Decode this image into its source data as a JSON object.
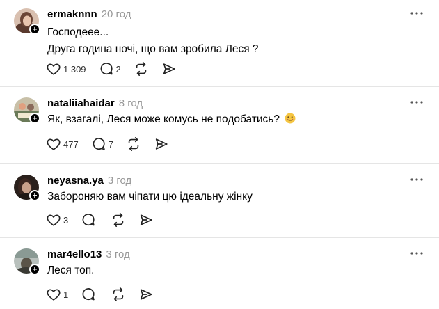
{
  "posts": [
    {
      "username": "ermaknnn",
      "time": "20 год",
      "lines": [
        "Господееe...",
        "Друга година ночі, що вам зробила Леся ?"
      ],
      "likes": "1 309",
      "replies": "2",
      "avatar_colors": [
        "#c89a82",
        "#5a3a2e"
      ]
    },
    {
      "username": "nataliiahaidar",
      "time": "8 год",
      "lines": [
        "Як, взагалі, Леся може комусь не подобатись?"
      ],
      "emoji": "smiling-face-emoji",
      "likes": "477",
      "replies": "7",
      "avatar_colors": [
        "#7a8a6a",
        "#d4c8a8"
      ]
    },
    {
      "username": "neyasna.ya",
      "time": "3 год",
      "lines": [
        "Забороняю вам чіпати цю ідеальну жінку"
      ],
      "likes": "3",
      "replies": "",
      "avatar_colors": [
        "#3a2a24",
        "#b8907a"
      ]
    },
    {
      "username": "mar4ello13",
      "time": "3 год",
      "lines": [
        "Леся топ."
      ],
      "likes": "1",
      "replies": "",
      "avatar_colors": [
        "#9aa6a0",
        "#4c4c44"
      ]
    }
  ],
  "icons": {
    "like": "heart-icon",
    "reply": "comment-icon",
    "repost": "repost-icon",
    "share": "send-icon",
    "more": "more-dots-icon",
    "follow": "plus-icon"
  },
  "colors": {
    "muted": "#999999",
    "divider": "#e5e5e5",
    "text": "#000000"
  }
}
